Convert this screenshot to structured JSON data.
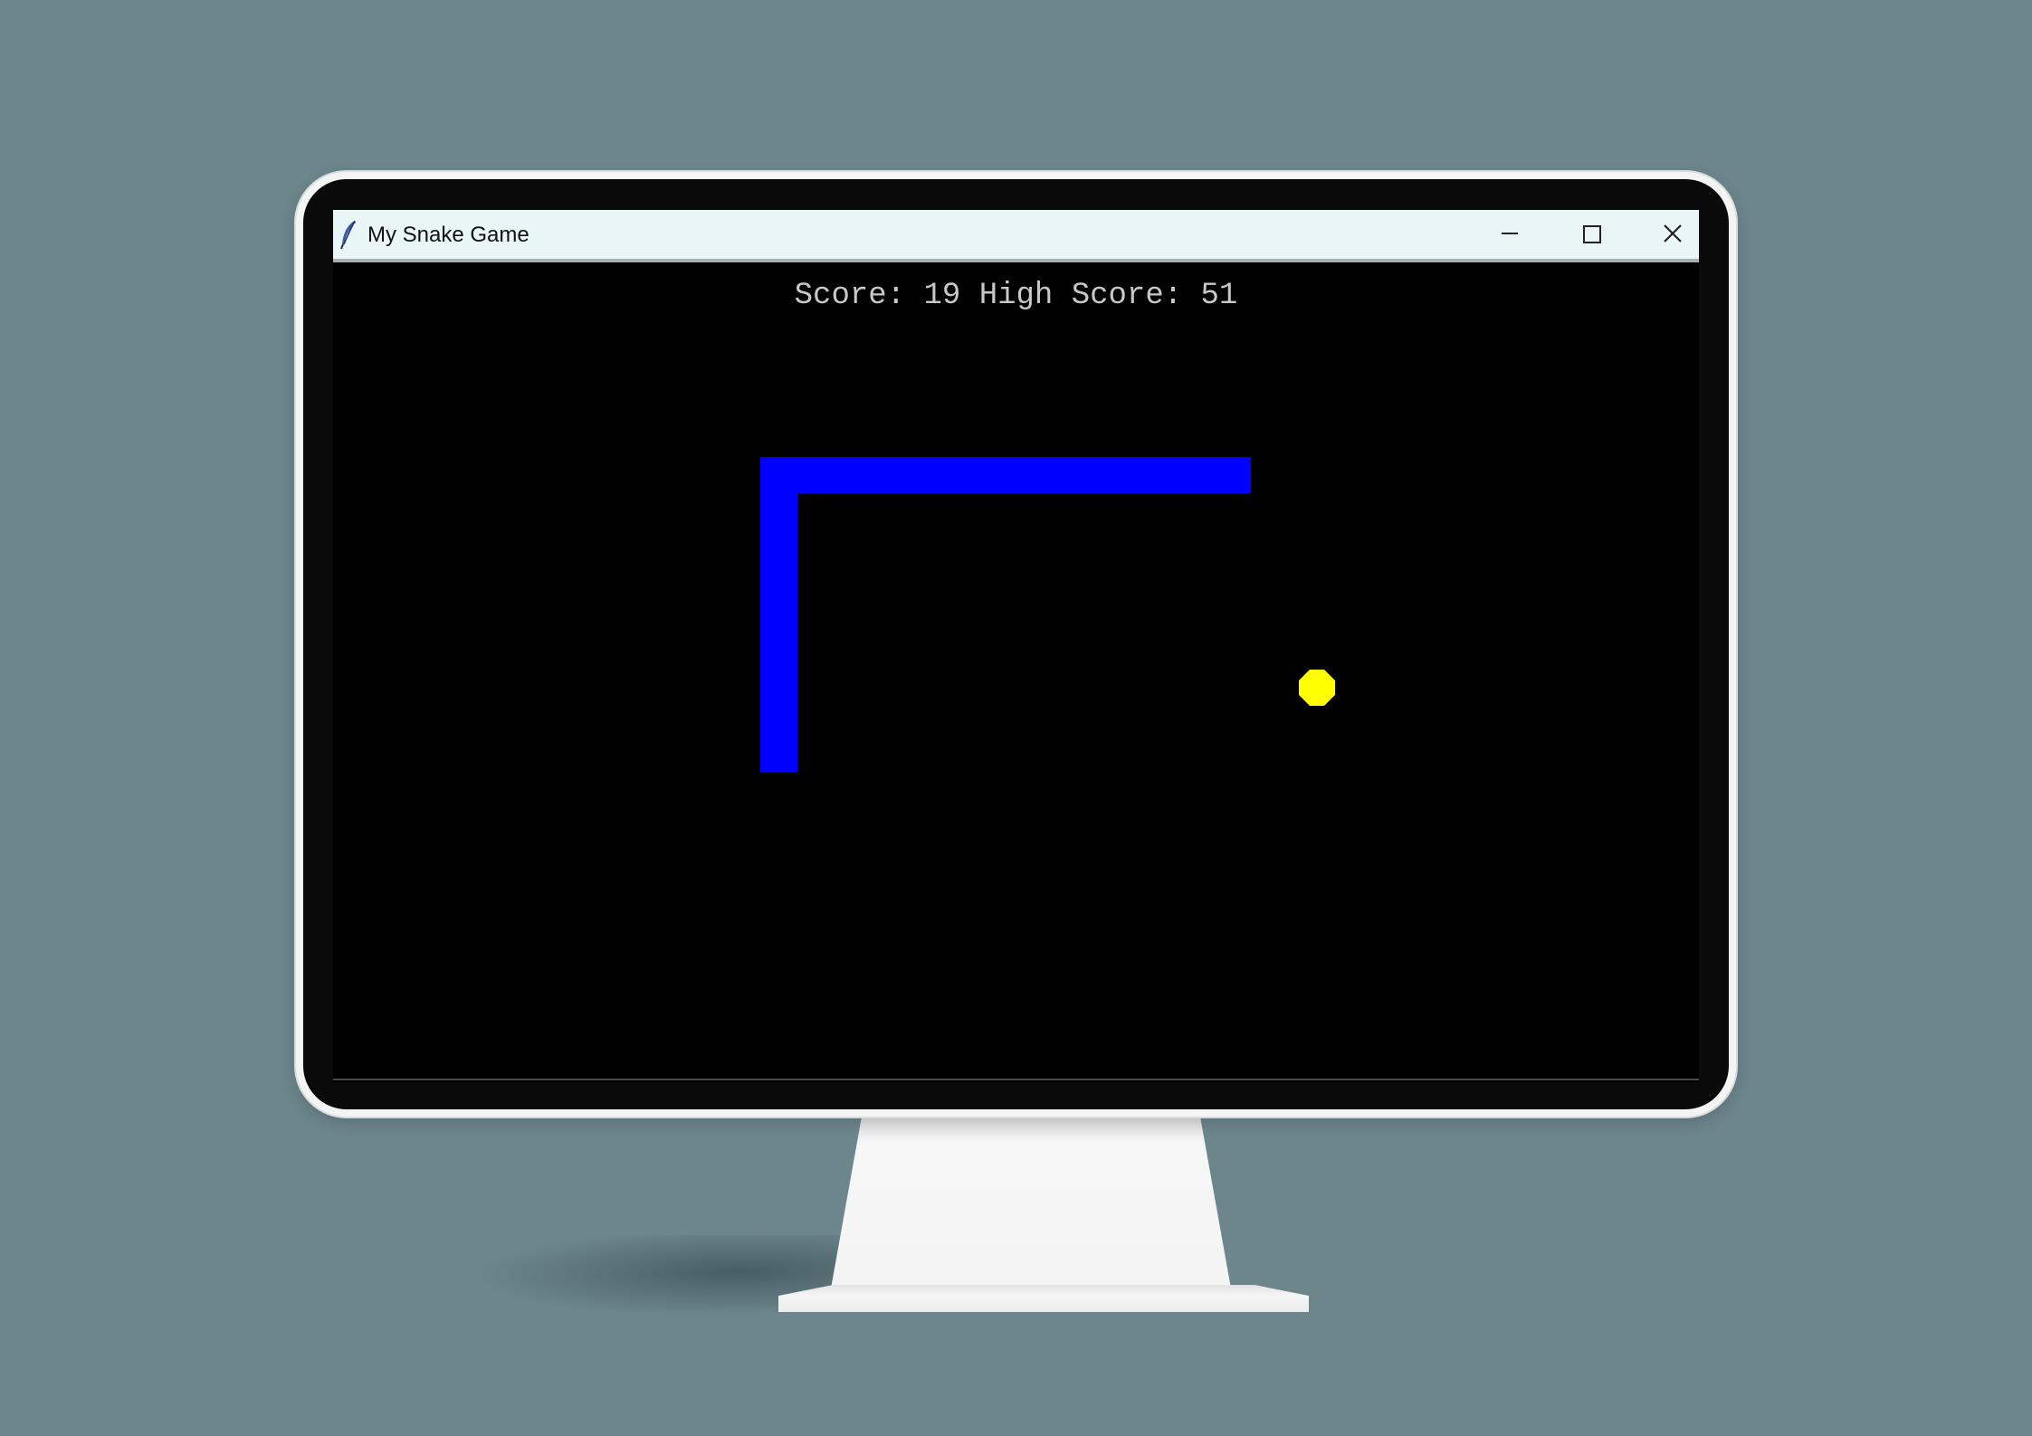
{
  "window": {
    "title": "My Snake Game",
    "icon": "feather-icon",
    "controls": [
      "minimize-icon",
      "maximize-icon",
      "close-icon"
    ]
  },
  "game": {
    "score_label": "Score: 19 High Score: 51",
    "score": 19,
    "high_score": 51,
    "colors": {
      "background": "#000000",
      "snake": "#0000ff",
      "food": "#ffff00",
      "score_text": "#c8c8c8"
    }
  }
}
